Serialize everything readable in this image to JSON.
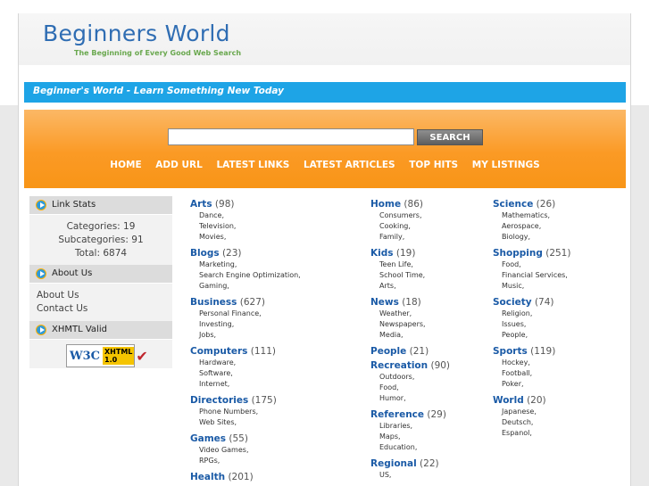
{
  "site": {
    "title": "Beginners World",
    "tagline": "The Beginning of Every Good Web Search",
    "banner": "Beginner's World - Learn Something New Today"
  },
  "search": {
    "value": "",
    "button_label": "SEARCH"
  },
  "nav": [
    "HOME",
    "ADD URL",
    "LATEST LINKS",
    "LATEST ARTICLES",
    "TOP HITS",
    "MY LISTINGS"
  ],
  "sidebar": {
    "link_stats": {
      "title": "Link Stats",
      "lines": [
        "Categories: 19",
        "Subcategories: 91",
        "Total: 6874"
      ]
    },
    "about": {
      "title": "About Us",
      "links": [
        "About Us",
        "Contact Us"
      ]
    },
    "valid": {
      "title": "XHMTL Valid",
      "badge_w3c": "W3C",
      "badge_text1": "XHTML",
      "badge_text2": "1.0"
    }
  },
  "columns": [
    [
      {
        "name": "Arts",
        "count": "(98)",
        "subs": [
          "Dance,",
          "Television,",
          "Movies,"
        ]
      },
      {
        "name": "Blogs",
        "count": "(23)",
        "subs": [
          "Marketing,",
          "Search Engine Optimization,",
          "Gaming,"
        ]
      },
      {
        "name": "Business",
        "count": "(627)",
        "subs": [
          "Personal Finance,",
          "Investing,",
          "Jobs,"
        ]
      },
      {
        "name": "Computers",
        "count": "(111)",
        "subs": [
          "Hardware,",
          "Software,",
          "Internet,"
        ]
      },
      {
        "name": "Directories",
        "count": "(175)",
        "subs": [
          "Phone Numbers,",
          "Web Sites,"
        ]
      },
      {
        "name": "Games",
        "count": "(55)",
        "subs": [
          "Video Games,",
          "RPGs,"
        ]
      },
      {
        "name": "Health",
        "count": "(201)",
        "subs": []
      }
    ],
    [
      {
        "name": "Home",
        "count": "(86)",
        "subs": [
          "Consumers,",
          "Cooking,",
          "Family,"
        ]
      },
      {
        "name": "Kids",
        "count": "(19)",
        "subs": [
          "Teen Life,",
          "School Time,",
          "Arts,"
        ]
      },
      {
        "name": "News",
        "count": "(18)",
        "subs": [
          "Weather,",
          "Newspapers,",
          "Media,"
        ]
      },
      {
        "name": "People",
        "count": "(21)",
        "subs": []
      },
      {
        "name": "Recreation",
        "count": "(90)",
        "subs": [
          "Outdoors,",
          "Food,",
          "Humor,"
        ]
      },
      {
        "name": "Reference",
        "count": "(29)",
        "subs": [
          "Libraries,",
          "Maps,",
          "Education,"
        ]
      },
      {
        "name": "Regional",
        "count": "(22)",
        "subs": [
          "US,"
        ]
      }
    ],
    [
      {
        "name": "Science",
        "count": "(26)",
        "subs": [
          "Mathematics,",
          "Aerospace,",
          "Biology,"
        ]
      },
      {
        "name": "Shopping",
        "count": "(251)",
        "subs": [
          "Food,",
          "Financial Services,",
          "Music,"
        ]
      },
      {
        "name": "Society",
        "count": "(74)",
        "subs": [
          "Religion,",
          "Issues,",
          "People,"
        ]
      },
      {
        "name": "Sports",
        "count": "(119)",
        "subs": [
          "Hockey,",
          "Football,",
          "Poker,"
        ]
      },
      {
        "name": "World",
        "count": "(20)",
        "subs": [
          "Japanese,",
          "Deutsch,",
          "Espanol,"
        ]
      }
    ]
  ]
}
